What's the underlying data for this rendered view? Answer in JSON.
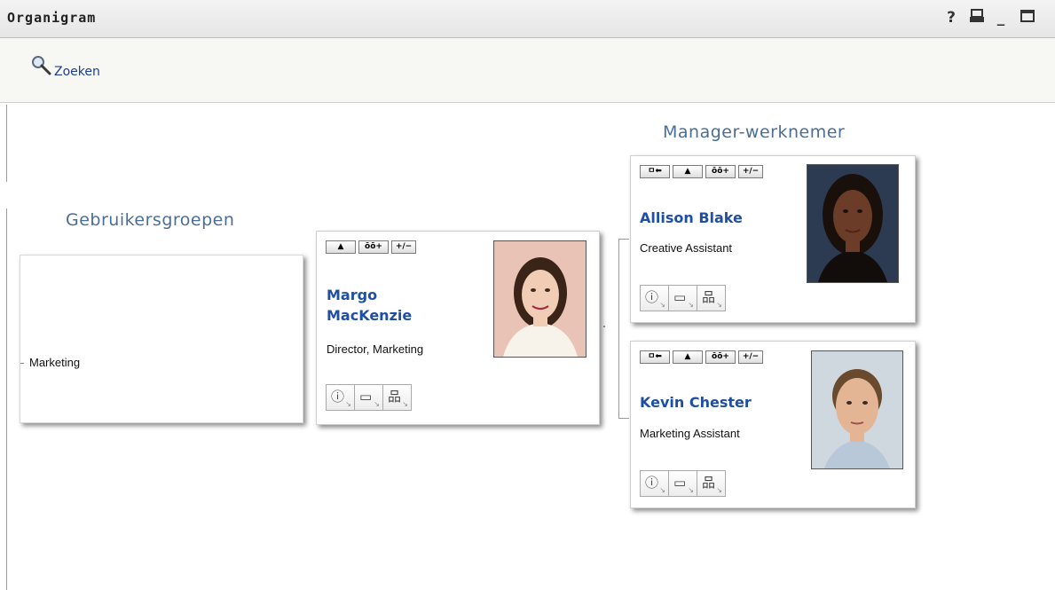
{
  "window": {
    "title": "Organigram",
    "controls": [
      "?",
      "🖶",
      "_",
      "□"
    ]
  },
  "toolbar": {
    "search_label": "Zoeken"
  },
  "sections": {
    "groups_title": "Gebruikersgroepen",
    "manager_title": "Manager-werknemer"
  },
  "group": {
    "name": "Marketing"
  },
  "card_buttons": {
    "collapse": "+/−",
    "expand_down": "ēē+",
    "up": "⬆",
    "to_manager": "⊟⬅"
  },
  "people": [
    {
      "name_line1": "Margo",
      "name_line2": "MacKenzie",
      "title": "Director, Marketing"
    },
    {
      "name": "Allison Blake",
      "title": "Creative Assistant"
    },
    {
      "name": "Kevin Chester",
      "title": "Marketing Assistant"
    }
  ],
  "icons": {
    "info": "ⓘ",
    "card": "▭",
    "org": "品"
  }
}
